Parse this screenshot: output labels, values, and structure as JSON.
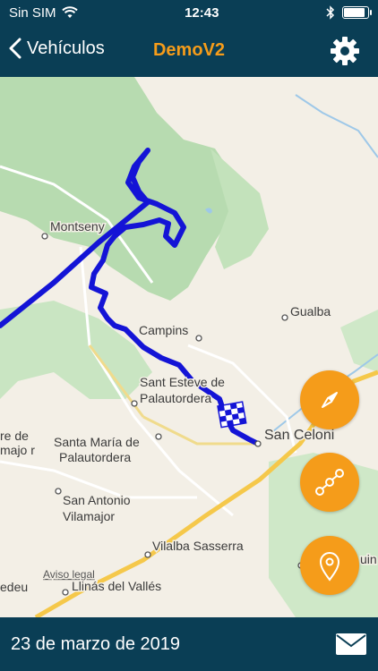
{
  "status": {
    "carrier": "Sin SIM",
    "time": "12:43",
    "battery_level": 0.9
  },
  "nav": {
    "back_label": "Vehículos",
    "title": "DemoV2"
  },
  "map": {
    "places": [
      "Montseny",
      "Gualba",
      "Campins",
      "Sant Esteve de",
      "Palautordera",
      "San Celoni",
      "re de",
      "majo r",
      "Santa María de",
      "Palautordera",
      "San Antonio",
      "Vilamajor",
      "Vilalba Sasserra",
      "Aviso legal",
      "edeu",
      "Llinás del Vallés",
      "uin"
    ],
    "attribution": "Aviso legal"
  },
  "footer": {
    "date": "23 de marzo de 2019"
  },
  "colors": {
    "bar": "#0a3e55",
    "accent": "#f59c1a",
    "route": "#1414d6"
  }
}
